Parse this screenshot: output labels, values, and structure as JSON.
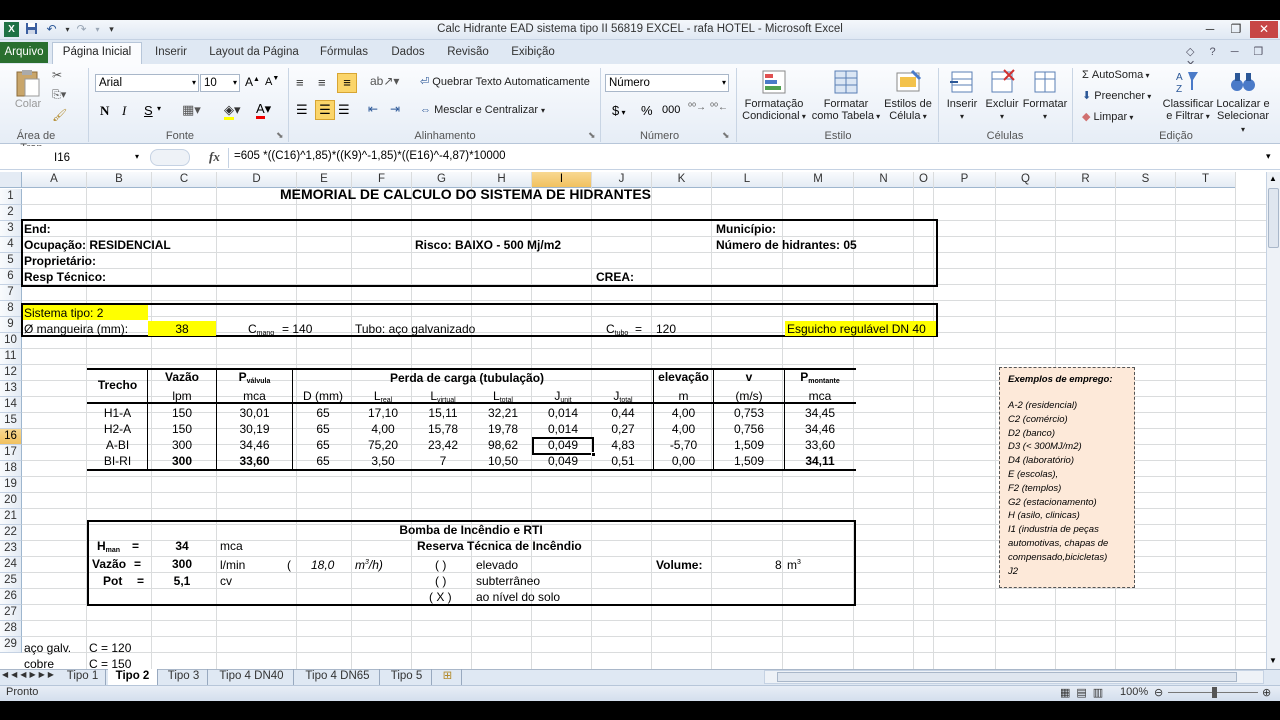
{
  "window": {
    "title": "Calc Hidrante EAD sistema tipo II  56819  EXCEL - rafa HOTEL  -  Microsoft Excel",
    "qa_save_icon": "save-icon",
    "qa_undo_icon": "undo-icon",
    "qa_redo_icon": "redo-icon",
    "qa_customize_icon": "customize-icon"
  },
  "ribbon_tabs": [
    "Arquivo",
    "Página Inicial",
    "Inserir",
    "Layout da Página",
    "Fórmulas",
    "Dados",
    "Revisão",
    "Exibição"
  ],
  "ribbon": {
    "clipboard": {
      "paste": "Colar",
      "group": "Área de Tran..."
    },
    "font": {
      "name": "Arial",
      "size": "10",
      "bold": "N",
      "italic": "I",
      "underline": "S",
      "group": "Fonte"
    },
    "alignment": {
      "wrap": "Quebrar Texto Automaticamente",
      "merge": "Mesclar e Centralizar",
      "group": "Alinhamento"
    },
    "number": {
      "format": "Número",
      "currency": "$",
      "percent": "%",
      "thousands": "000",
      "group": "Número"
    },
    "styles": {
      "cond": "Formatação",
      "cond2": "Condicional",
      "table": "Formatar",
      "table2": "como Tabela",
      "cell": "Estilos de",
      "cell2": "Célula",
      "group": "Estilo"
    },
    "cells": {
      "insert": "Inserir",
      "delete": "Excluir",
      "format": "Formatar",
      "group": "Células"
    },
    "editing": {
      "autosum": "AutoSoma",
      "fill": "Preencher",
      "clear": "Limpar",
      "sort": "Classificar",
      "sort2": "e Filtrar",
      "find": "Localizar e",
      "find2": "Selecionar",
      "group": "Edição"
    }
  },
  "formula_bar": {
    "cell": "I16",
    "fx": "fx",
    "formula": "=605 *((C16)^1,85)*((K9)^-1,85)*((E16)^-4,87)*10000"
  },
  "columns": [
    "A",
    "B",
    "C",
    "D",
    "E",
    "F",
    "G",
    "H",
    "I",
    "J",
    "K",
    "L",
    "M",
    "N",
    "O",
    "P",
    "Q",
    "R",
    "S",
    "T"
  ],
  "rows": [
    "1",
    "2",
    "3",
    "4",
    "5",
    "6",
    "7",
    "8",
    "9",
    "10",
    "11",
    "12",
    "13",
    "14",
    "15",
    "16",
    "17",
    "18",
    "19",
    "20",
    "21",
    "22",
    "23",
    "24",
    "25",
    "26",
    "27",
    "28",
    "29"
  ],
  "sheet": {
    "title": "MEMORIAL DE CALCULO DO SISTEMA DE HIDRANTES",
    "end": "End:",
    "municipio": "Município:",
    "ocupacao": "Ocupação: RESIDENCIAL",
    "risco": "Risco: BAIXO - 500 Mj/m2",
    "num_hidrantes": "Número de hidrantes: 05",
    "proprietario": "Proprietário:",
    "resp": "Resp Técnico:",
    "crea": "CREA:",
    "sistema": "Sistema tipo: 2",
    "mangueira": "Ø mangueira (mm):",
    "mangueira_val": "38",
    "c_mang": "C",
    "c_mang_sub": "mang",
    "c_mang_val": "=  140",
    "tubo": "Tubo: aço galvanizado",
    "c_tubo": "C",
    "c_tubo_sub": "tubo",
    "c_tubo_eq": "=",
    "c_tubo_val": "120",
    "esguicho": "Esguicho regulável DN 40",
    "table": {
      "h_trecho": "Trecho",
      "h_vazao": "Vazão",
      "h_vazao_u": "lpm",
      "h_pv": "P",
      "h_pv_sub": "válvula",
      "h_pv_u": "mca",
      "h_perda": "Perda de carga  (tubulação)",
      "h_d": "D (mm)",
      "h_lreal": "L",
      "h_lreal_sub": "real",
      "h_lvirt": "L",
      "h_lvirt_sub": "virtual",
      "h_ltot": "L",
      "h_ltot_sub": "total",
      "h_junit": "J",
      "h_junit_sub": "unit",
      "h_jtot": "J",
      "h_jtot_sub": "total",
      "h_elev": "elevação",
      "h_elev_u": "m",
      "h_v": "v",
      "h_v_u": "(m/s)",
      "h_pm": "P",
      "h_pm_sub": "montante",
      "h_pm_u": "mca",
      "rows": [
        {
          "trecho": "H1-A",
          "vazao": "150",
          "pv": "30,01",
          "d": "65",
          "lreal": "17,10",
          "lvirt": "15,11",
          "ltot": "32,21",
          "junit": "0,014",
          "jtot": "0,44",
          "elev": "4,00",
          "v": "0,753",
          "pm": "34,45"
        },
        {
          "trecho": "H2-A",
          "vazao": "150",
          "pv": "30,19",
          "d": "65",
          "lreal": "4,00",
          "lvirt": "15,78",
          "ltot": "19,78",
          "junit": "0,014",
          "jtot": "0,27",
          "elev": "4,00",
          "v": "0,756",
          "pm": "34,46"
        },
        {
          "trecho": "A-BI",
          "vazao": "300",
          "pv": "34,46",
          "d": "65",
          "lreal": "75,20",
          "lvirt": "23,42",
          "ltot": "98,62",
          "junit": "0,049",
          "jtot": "4,83",
          "elev": "-5,70",
          "v": "1,509",
          "pm": "33,60"
        },
        {
          "trecho": "BI-RI",
          "vazao": "300",
          "pv": "33,60",
          "d": "65",
          "lreal": "3,50",
          "lvirt": "7",
          "ltot": "10,50",
          "junit": "0,049",
          "jtot": "0,51",
          "elev": "0,00",
          "v": "1,509",
          "pm": "34,11"
        }
      ]
    },
    "bomba": {
      "title": "Bomba de Incêndio e RTI",
      "hman": "H",
      "hman_sub": "man",
      "eq": "=",
      "hman_val": "34",
      "hman_u": "mca",
      "reserva": "Reserva Técnica de Incêndio",
      "vazao": "Vazão",
      "vazao_val": "300",
      "vazao_u": "l/min",
      "paren_open": "(",
      "m3h_val": "18,0",
      "m3h_u": "m",
      "m3h_sup": "3",
      "m3h_end": "/h)",
      "opt1_mark": "(   )",
      "opt1": "elevado",
      "opt2_mark": "(   )",
      "opt2": "subterrâneo",
      "opt3_mark": "( X )",
      "opt3": "ao nível do solo",
      "volume": "Volume:",
      "volume_val": "8",
      "volume_u": "m",
      "volume_sup": "3",
      "pot": "Pot",
      "pot_val": "5,1",
      "pot_u": "cv"
    },
    "r28a": "aço galv.",
    "r28b": "C = 120",
    "r29a": "cobre",
    "r29b": "C = 150",
    "exemplos": {
      "title": "Exemplos de emprego:",
      "items": [
        "A-2 (residencial)",
        "C2 (comércio)",
        "D2 (banco)",
        "D3 (< 300MJ/m2)",
        "D4 (laboratório)",
        "E (escolas),",
        "F2 (templos)",
        "G2 (estacionamento)",
        "H (asilo, clinicas)",
        "I1 (industria de  peças",
        "automotivas, chapas de",
        "compensado,bicicletas)",
        "J2"
      ]
    }
  },
  "sheet_tabs": [
    "Tipo 1",
    "Tipo 2",
    "Tipo 3",
    "Tipo 4 DN40",
    "Tipo 4 DN65",
    "Tipo 5"
  ],
  "active_tab": "Tipo 2",
  "status": {
    "ready": "Pronto",
    "zoom": "100%"
  },
  "colors": {
    "yellow": "#ffff00",
    "note_bg": "#fde9d9",
    "selected_header": "#f1c15f",
    "file_tab": "#2a6f2f"
  }
}
